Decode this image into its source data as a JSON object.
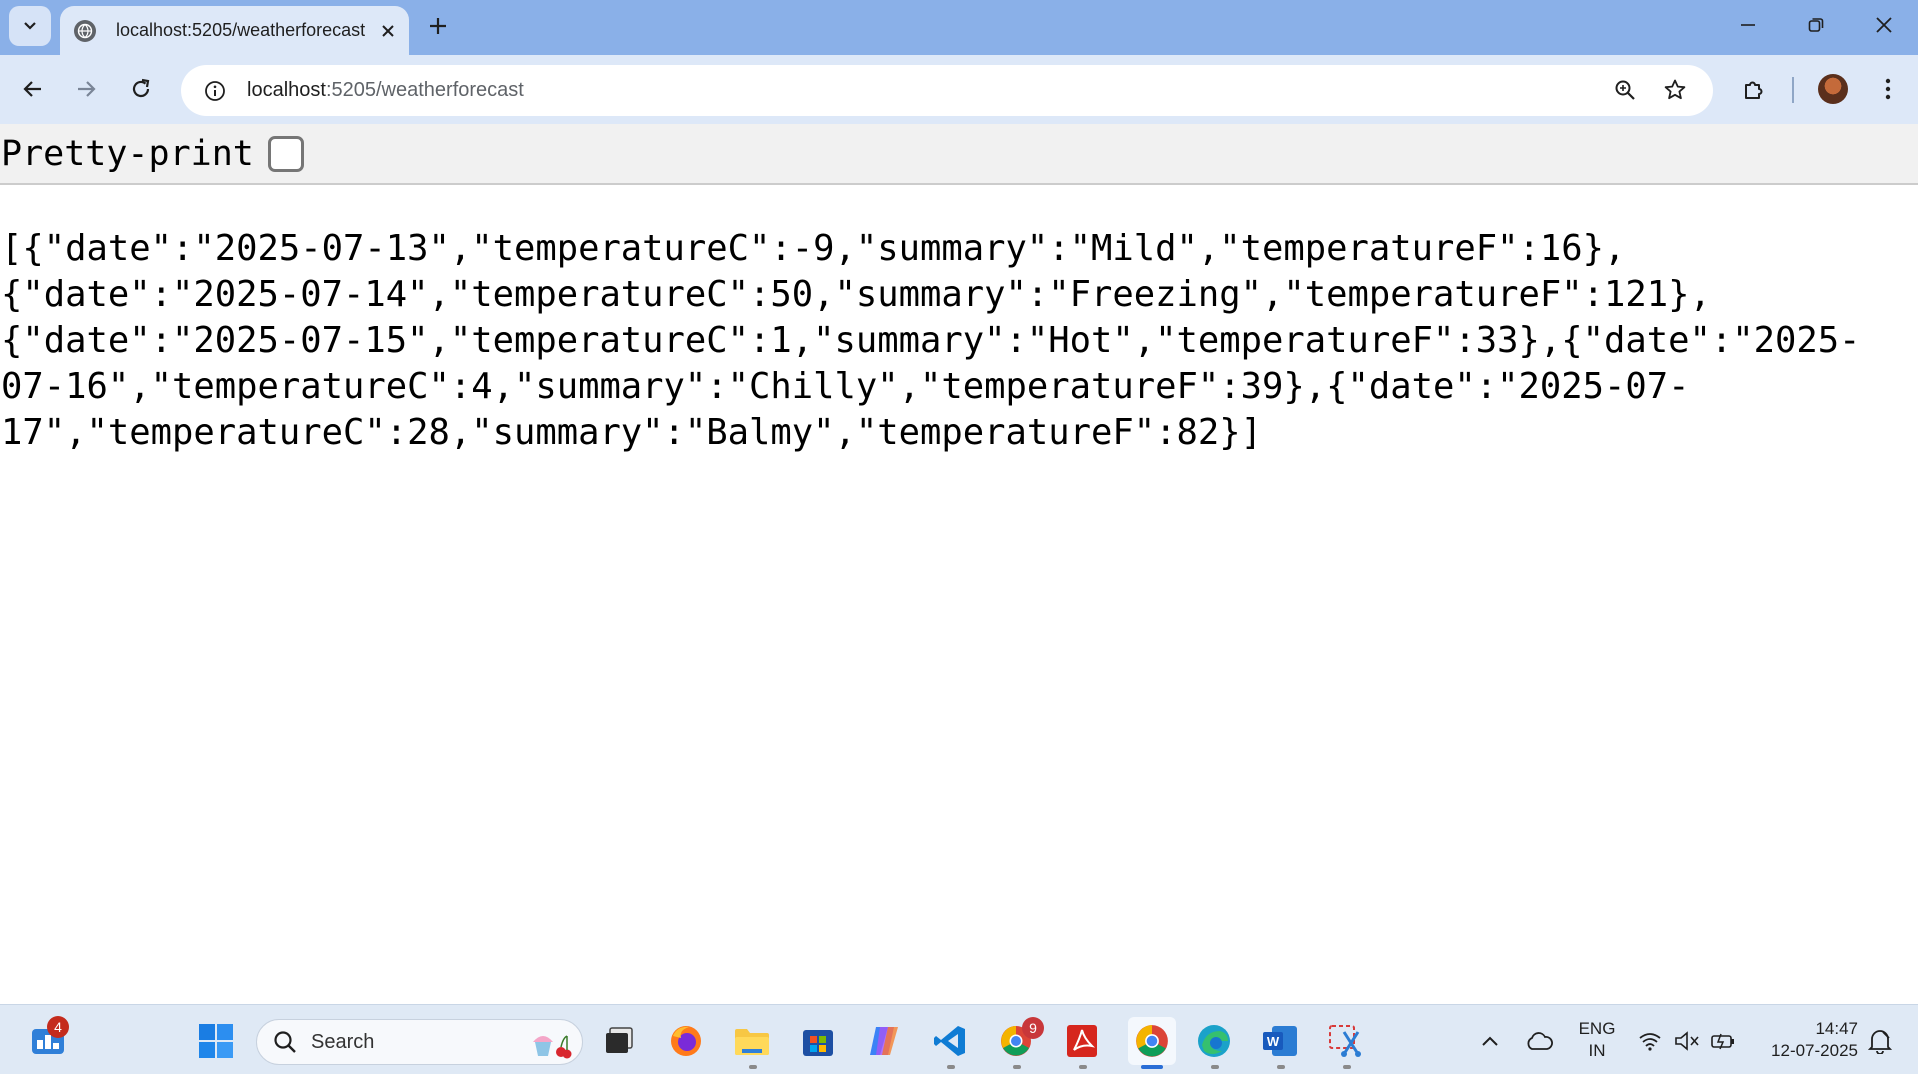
{
  "browser": {
    "tab": {
      "title": "localhost:5205/weatherforecast"
    },
    "address": {
      "host": "localhost",
      "path": ":5205/weatherforecast"
    }
  },
  "page": {
    "pretty_print_label": "Pretty-print",
    "pretty_print_checked": false,
    "json_text": "[{\"date\":\"2025-07-13\",\"temperatureC\":-9,\"summary\":\"Mild\",\"temperatureF\":16},{\"date\":\"2025-07-14\",\"temperatureC\":50,\"summary\":\"Freezing\",\"temperatureF\":121},{\"date\":\"2025-07-15\",\"temperatureC\":1,\"summary\":\"Hot\",\"temperatureF\":33},{\"date\":\"2025-07-16\",\"temperatureC\":4,\"summary\":\"Chilly\",\"temperatureF\":39},{\"date\":\"2025-07-17\",\"temperatureC\":28,\"summary\":\"Balmy\",\"temperatureF\":82}]",
    "json_lines": [
      "[{\"date\":\"2025-07-13\",\"temperatureC\":-9,\"summary\":\"Mild\",\"temperatureF\":16},",
      "{\"date\":\"2025-07-14\",\"temperatureC\":50,\"summary\":\"Freezing\",\"temperatureF\":121},",
      "{\"date\":\"2025-07-15\",\"temperatureC\":1,\"summary\":\"Hot\",\"temperatureF\":33},{\"date\":\"2025-",
      "07-16\",\"temperatureC\":4,\"summary\":\"Chilly\",\"temperatureF\":39},{\"date\":\"2025-07-",
      "17\",\"temperatureC\":28,\"summary\":\"Balmy\",\"temperatureF\":82}]"
    ]
  },
  "taskbar": {
    "widgets_badge": "4",
    "search_placeholder": "Search",
    "chrome_badge": "9",
    "language": {
      "line1": "ENG",
      "line2": "IN"
    },
    "clock": {
      "time": "14:47",
      "date": "12-07-2025"
    }
  },
  "colors": {
    "title_bar": "#8ab0e8",
    "toolbar": "#dde8f8",
    "taskbar": "#dfe9f5",
    "accent": "#2a6ed6"
  }
}
